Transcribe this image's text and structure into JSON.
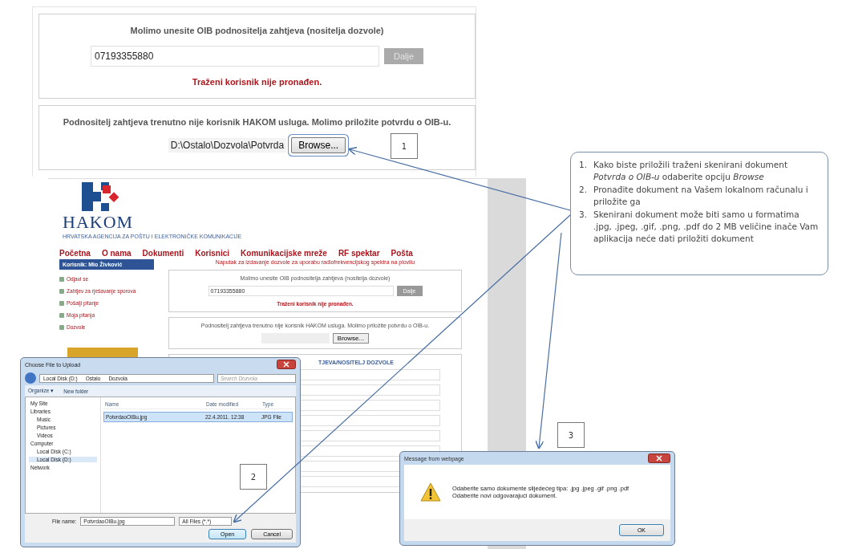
{
  "oib_panel": {
    "prompt": "Molimo unesite OIB podnositelja zahtjeva (nositelja dozvole)",
    "oib_value": "07193355880",
    "next_button": "Dalje",
    "error": "Traženi korisnik nije pronađen."
  },
  "upload_panel": {
    "message": "Podnositelj zahtjeva trenutno nije korisnik HAKOM usluga. Molimo priložite potvrdu o OIB-u.",
    "file_path": "D:\\Ostalo\\Dozvola\\Potvrda",
    "browse_button": "Browse..."
  },
  "step_badges": [
    "1",
    "2",
    "3"
  ],
  "instructions": [
    {
      "number": "1.",
      "text": "Kako biste priložili traženi skenirani dokument *Potvrda o OIB-u* odaberite opciju *Browse*"
    },
    {
      "number": "2.",
      "text": "Pronađite dokument na Vašem lokalnom računalu i priložite ga"
    },
    {
      "number": "3.",
      "text": "Skenirani dokument može biti samo u formatima .jpg, .jpeg, .gif, .png, .pdf  do 2 MB veličine inače Vam aplikacija neće dati priložiti dokument"
    }
  ],
  "website": {
    "logo_name": "HAKOM",
    "logo_subtitle": "HRVATSKA AGENCIJA ZA POŠTU I ELEKTRONIČKE KOMUNIKACIJE",
    "nav": [
      "Početna",
      "O nama",
      "Dokumenti",
      "Korisnici",
      "Komunikacijske mreže",
      "RF spektar",
      "Pošta"
    ],
    "user_label": "Korisnik: Mio Živković",
    "notice": "Naputak za izdavanje dozvole za uporabu radiofrekvencijskog spektra na plovilu",
    "sidebar_items": [
      "Odjavi se",
      "Zahtjev za rješavanje sporova",
      "Pošalji pitanje",
      "Moja pitanja",
      "Dozvole"
    ],
    "oib_prompt": "Molimo unesite OIB podnositelja zahtjeva (nositelja dozvole)",
    "oib_value": "07193355880",
    "next_button": "Dalje",
    "error": "Traženi korisnik nije pronađen.",
    "upload_message": "Podnositelj zahtjeva trenutno nije korisnik HAKOM usluga. Molimo priložite potvrdu o OIB-u.",
    "browse_button": "Browse...",
    "section_title": "TJEVA/NOSITELJ DOZVOLE"
  },
  "file_dialog": {
    "title": "Choose File to Upload",
    "path": [
      "Local Disk (D:)",
      "Ostalo",
      "Dozvola"
    ],
    "search_placeholder": "Search Dozvola",
    "organize": "Organize ▾",
    "new_folder": "New folder",
    "tree": [
      {
        "label": "My Site",
        "selected": false
      },
      {
        "label": "Libraries",
        "selected": false,
        "children": [
          {
            "label": "Music",
            "selected": false
          },
          {
            "label": "Pictures",
            "selected": false
          },
          {
            "label": "Videos",
            "selected": false
          }
        ]
      },
      {
        "label": "Computer",
        "selected": false,
        "children": [
          {
            "label": "Local Disk (C:)",
            "selected": false
          },
          {
            "label": "Local Disk (D:)",
            "selected": true
          }
        ]
      },
      {
        "label": "Network",
        "selected": false
      }
    ],
    "columns": [
      "Name",
      "Date modified",
      "Type"
    ],
    "files": [
      {
        "name": "PotvrdaoOIBu.jpg",
        "date": "22.4.2011. 12:38",
        "type": "JPG File",
        "selected": true
      }
    ],
    "file_name_label": "File name:",
    "file_name": "PotvrdaoOIBu.jpg",
    "filter": "All Files (*.*)",
    "open_button": "Open",
    "cancel_button": "Cancel"
  },
  "message_box": {
    "title": "Message from webpage",
    "lines": [
      "Odaberite samo dokumente slijedećeg tipa:  .jpg  .jpeg  .gif  .png  .pdf",
      "Odaberite novi odgovarajući dokument."
    ],
    "ok_button": "OK"
  }
}
